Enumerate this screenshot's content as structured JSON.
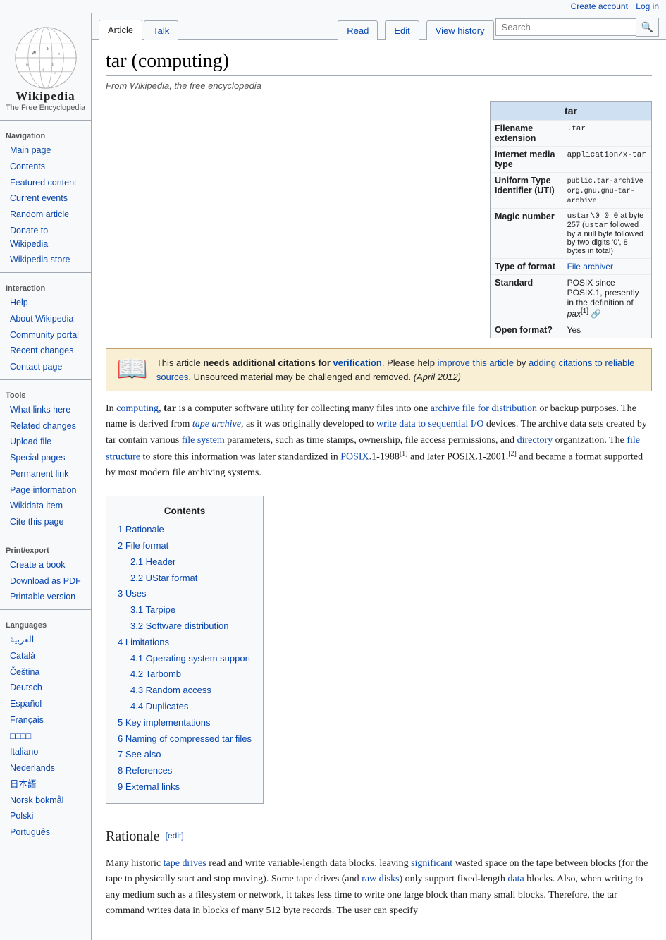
{
  "topbar": {
    "create_account": "Create account",
    "log_in": "Log in"
  },
  "sidebar": {
    "logo_title": "Wikipedia",
    "logo_subtitle": "The Free Encyclopedia",
    "nav_label": "Navigation",
    "nav_items": [
      {
        "label": "Main page",
        "href": "#"
      },
      {
        "label": "Contents",
        "href": "#"
      },
      {
        "label": "Featured content",
        "href": "#"
      },
      {
        "label": "Current events",
        "href": "#"
      },
      {
        "label": "Random article",
        "href": "#"
      },
      {
        "label": "Donate to Wikipedia",
        "href": "#"
      },
      {
        "label": "Wikipedia store",
        "href": "#"
      }
    ],
    "interaction_label": "Interaction",
    "interaction_items": [
      {
        "label": "Help",
        "href": "#"
      },
      {
        "label": "About Wikipedia",
        "href": "#"
      },
      {
        "label": "Community portal",
        "href": "#"
      },
      {
        "label": "Recent changes",
        "href": "#"
      },
      {
        "label": "Contact page",
        "href": "#"
      }
    ],
    "tools_label": "Tools",
    "tools_items": [
      {
        "label": "What links here",
        "href": "#"
      },
      {
        "label": "Related changes",
        "href": "#"
      },
      {
        "label": "Upload file",
        "href": "#"
      },
      {
        "label": "Special pages",
        "href": "#"
      },
      {
        "label": "Permanent link",
        "href": "#"
      },
      {
        "label": "Page information",
        "href": "#"
      },
      {
        "label": "Wikidata item",
        "href": "#"
      },
      {
        "label": "Cite this page",
        "href": "#"
      }
    ],
    "print_label": "Print/export",
    "print_items": [
      {
        "label": "Create a book",
        "href": "#"
      },
      {
        "label": "Download as PDF",
        "href": "#"
      },
      {
        "label": "Printable version",
        "href": "#"
      }
    ],
    "languages_label": "Languages",
    "language_items": [
      {
        "label": "العربية"
      },
      {
        "label": "Català"
      },
      {
        "label": "Čeština"
      },
      {
        "label": "Deutsch"
      },
      {
        "label": "Español"
      },
      {
        "label": "Français"
      },
      {
        "label": "□□□□"
      },
      {
        "label": "Italiano"
      },
      {
        "label": "Nederlands"
      },
      {
        "label": "日本語"
      },
      {
        "label": "Norsk bokmål"
      },
      {
        "label": "Polski"
      },
      {
        "label": "Português"
      }
    ]
  },
  "tabs": {
    "article": "Article",
    "talk": "Talk",
    "read": "Read",
    "edit": "Edit",
    "view_history": "View history"
  },
  "search": {
    "placeholder": "Search",
    "button": "🔍"
  },
  "article": {
    "title": "tar (computing)",
    "subtitle": "From Wikipedia, the free encyclopedia",
    "notice": {
      "icon": "📖",
      "text_prefix": "This article ",
      "needs": "needs additional citations for",
      "needs_link": "verification",
      "text_mid": ". Please help ",
      "improve_link": "improve this article",
      "text_mid2": " by ",
      "adding_link": "adding citations to reliable sources",
      "text_suffix": ". Unsourced material may be challenged and removed.",
      "date": " (April 2012)"
    },
    "infobox": {
      "title": "tar",
      "rows": [
        {
          "label": "Filename extension",
          "value": ".tar"
        },
        {
          "label": "Internet media type",
          "value": "application/x-tar"
        },
        {
          "label": "Uniform Type Identifier (UTI)",
          "value": "public.tar-archive\norg.gnu.gnu-tar-archive"
        },
        {
          "label": "Magic number",
          "value": "ustar\\0 0 0 at byte 257 (ustar followed by a null byte followed by two digits '0', 8 bytes in total)"
        },
        {
          "label": "Type of format",
          "value": "File archiver",
          "link": true
        },
        {
          "label": "Standard",
          "value": "POSIX since POSIX.1, presently in the definition of pax[1]"
        },
        {
          "label": "Open format?",
          "value": "Yes"
        }
      ]
    },
    "body_intro": "In computing, tar is a computer software utility for collecting many files into one archive file for distribution or backup purposes. The name is derived from tape archive, as it was originally developed to write data to sequential I/O devices. The archive data sets created by tar contain various file system parameters, such as time stamps, ownership, file access permissions, and directory organization. The file structure to store this information was later standardized in POSIX.1-1988[1] and later POSIX.1-2001.[2] and became a format supported by most modern file archiving systems.",
    "toc": {
      "title": "Contents",
      "items": [
        {
          "num": "1",
          "label": "Rationale",
          "sub": []
        },
        {
          "num": "2",
          "label": "File format",
          "sub": [
            {
              "num": "2.1",
              "label": "Header"
            },
            {
              "num": "2.2",
              "label": "UStar format"
            }
          ]
        },
        {
          "num": "3",
          "label": "Uses",
          "sub": [
            {
              "num": "3.1",
              "label": "Tarpipe"
            },
            {
              "num": "3.2",
              "label": "Software distribution"
            }
          ]
        },
        {
          "num": "4",
          "label": "Limitations",
          "sub": [
            {
              "num": "4.1",
              "label": "Operating system support"
            },
            {
              "num": "4.2",
              "label": "Tarbomb"
            },
            {
              "num": "4.3",
              "label": "Random access"
            },
            {
              "num": "4.4",
              "label": "Duplicates"
            }
          ]
        },
        {
          "num": "5",
          "label": "Key implementations",
          "sub": []
        },
        {
          "num": "6",
          "label": "Naming of compressed tar files",
          "sub": []
        },
        {
          "num": "7",
          "label": "See also",
          "sub": []
        },
        {
          "num": "8",
          "label": "References",
          "sub": []
        },
        {
          "num": "9",
          "label": "External links",
          "sub": []
        }
      ]
    },
    "rationale_heading": "Rationale",
    "rationale_edit": "[edit]",
    "rationale_text": "Many historic tape drives read and write variable-length data blocks, leaving significant wasted space on the tape between blocks (for the tape to physically start and stop moving). Some tape drives (and raw disks) only support fixed-length data blocks. Also, when writing to any medium such as a filesystem or network, it takes less time to write one large block than many small blocks. Therefore, the tar command writes data in blocks of many 512 byte records. The user can specify"
  }
}
